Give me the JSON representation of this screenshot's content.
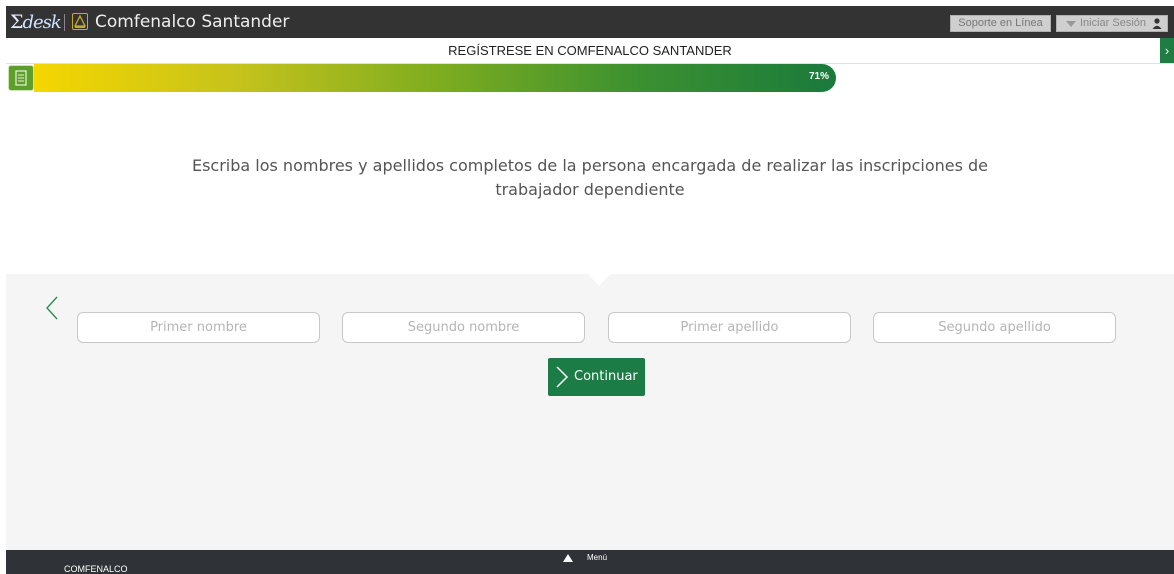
{
  "app": {
    "logo_text": "desk",
    "logo_symbol": "Σ",
    "brand_name": "Comfenalco Santander",
    "brand_icon": "comfenalco-logo-icon"
  },
  "header": {
    "support_label": "Soporte en Línea",
    "login_label": "Iniciar Sesión",
    "login_icon": "user-icon",
    "login_caret_icon": "caret-down-icon"
  },
  "title_bar": {
    "title": "REGÍSTRESE EN COMFENALCO SANTANDER",
    "close_icon": "close-icon"
  },
  "progress": {
    "value_label": "71%",
    "fraction": 0.71,
    "icon": "document-icon",
    "colors": [
      "#f5d600",
      "#1a7a3c"
    ]
  },
  "question": {
    "text": "Escriba los nombres y apellidos completos de la persona encargada de realizar las inscripciones de trabajador dependiente"
  },
  "form": {
    "back_icon": "chevron-left-icon",
    "fields": [
      {
        "placeholder": "Primer nombre",
        "value": ""
      },
      {
        "placeholder": "Segundo nombre",
        "value": ""
      },
      {
        "placeholder": "Primer apellido",
        "value": ""
      },
      {
        "placeholder": "Segundo apellido",
        "value": ""
      }
    ],
    "continue_label": "Continuar",
    "continue_icon": "chevron-right-icon"
  },
  "footer": {
    "menu_label": "Menú",
    "menu_icon": "triangle-up-icon",
    "company_label": "COMFENALCO"
  },
  "colors": {
    "accent": "#1b7c46",
    "topbar": "#333333",
    "form_background": "#f5f5f5"
  }
}
